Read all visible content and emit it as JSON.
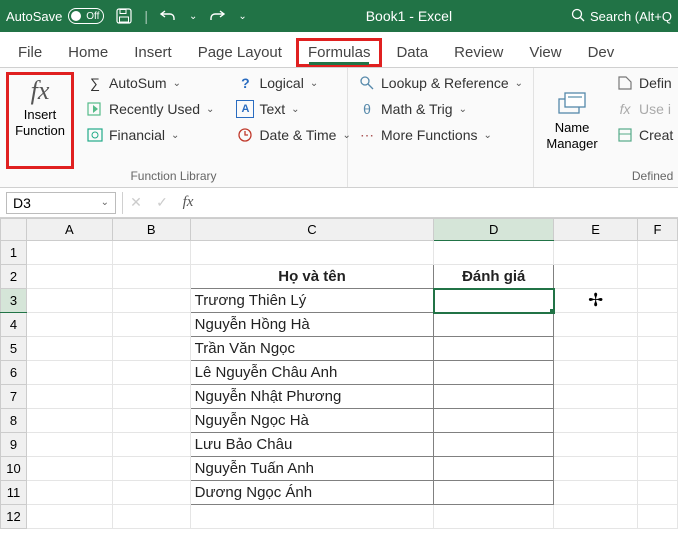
{
  "title": {
    "autosave": "AutoSave",
    "autosave_state": "Off",
    "book": "Book1  -  Excel",
    "search": "Search (Alt+Q"
  },
  "tabs": [
    "File",
    "Home",
    "Insert",
    "Page Layout",
    "Formulas",
    "Data",
    "Review",
    "View",
    "Dev"
  ],
  "ribbon": {
    "insert_function": [
      "Insert",
      "Function"
    ],
    "lib": {
      "autosum": "AutoSum",
      "recent": "Recently Used",
      "financial": "Financial",
      "logical": "Logical",
      "text": "Text",
      "datetime": "Date & Time",
      "lookup": "Lookup & Reference",
      "mathtrig": "Math & Trig",
      "more": "More Functions"
    },
    "group_lib": "Function Library",
    "name_mgr": [
      "Name",
      "Manager"
    ],
    "defined": {
      "define": "Defin",
      "use": "Use i",
      "create": "Creat"
    },
    "group_def": "Defined"
  },
  "fbar": {
    "namebox": "D3"
  },
  "grid": {
    "cols": [
      "A",
      "B",
      "C",
      "D",
      "E",
      "F"
    ],
    "rows": [
      1,
      2,
      3,
      4,
      5,
      6,
      7,
      8,
      9,
      10,
      11,
      12
    ],
    "header": {
      "c": "Họ và tên",
      "d": "Đánh giá"
    },
    "names": [
      "Trương Thiên Lý",
      "Nguyễn Hồng Hà",
      "Trần Văn Ngọc",
      "Lê Nguyễn Châu Anh",
      "Nguyễn Nhật Phương",
      "Nguyễn Ngọc Hà",
      "Lưu Bảo Châu",
      "Nguyễn Tuấn Anh",
      "Dương Ngọc Ánh"
    ]
  }
}
